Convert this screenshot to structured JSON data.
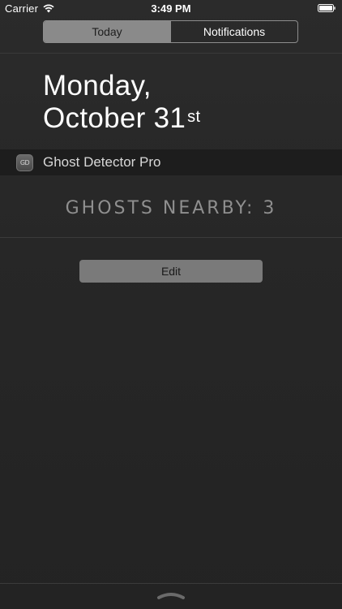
{
  "status_bar": {
    "carrier": "Carrier",
    "time": "3:49 PM"
  },
  "tabs": [
    {
      "label": "Today",
      "active": true
    },
    {
      "label": "Notifications",
      "active": false
    }
  ],
  "date": {
    "weekday": "Monday,",
    "month_day": "October 31",
    "suffix": "st"
  },
  "widget": {
    "app_icon_text": "GD",
    "title": "Ghost Detector Pro",
    "content": "GHOSTS NEARBY: 3"
  },
  "edit_button": {
    "label": "Edit"
  },
  "colors": {
    "background": "#262626",
    "segment_active": "#8a8a8a",
    "widget_header": "#1d1d1d",
    "ghost_text": "#8f8f8f",
    "edit_button": "#7a7a7a"
  },
  "icons": {
    "wifi": "wifi-icon",
    "battery": "battery-icon",
    "grabber": "grabber-handle-icon"
  }
}
